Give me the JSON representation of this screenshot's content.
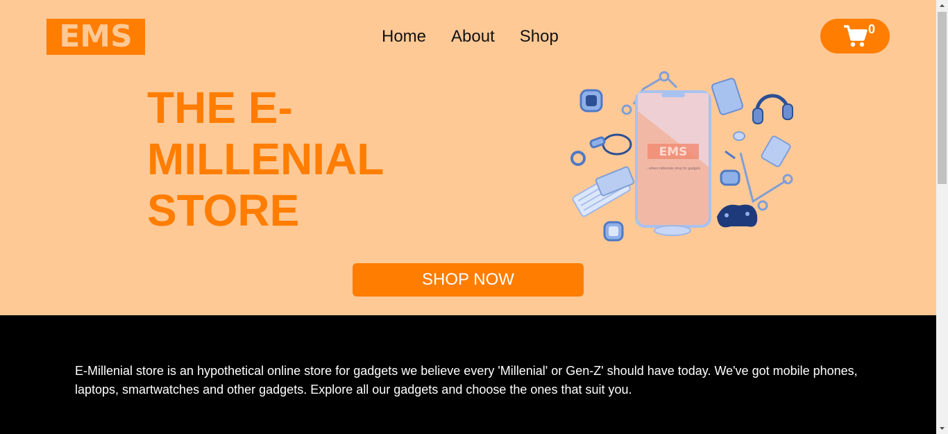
{
  "brand": {
    "logo_text": "EMS"
  },
  "nav": {
    "items": [
      {
        "label": "Home"
      },
      {
        "label": "About"
      },
      {
        "label": "Shop"
      }
    ]
  },
  "cart": {
    "count": "0",
    "icon": "cart-icon"
  },
  "hero": {
    "title_lines": [
      "THE E-",
      "MILLENIAL",
      "STORE"
    ],
    "cta_label": "SHOP NOW",
    "phone_screen_logo": "EMS",
    "phone_screen_tagline": "...where millenials shop for gadgets"
  },
  "about": {
    "text": "E-Millenial store is an hypothetical online store for gadgets we believe every 'Millenial' or Gen-Z' should have today. We've got mobile phones, laptops, smartwatches and other gadgets. Explore all our gadgets and choose the ones that suit you."
  },
  "colors": {
    "accent": "#ff7d00",
    "hero_bg": "#ffc996",
    "about_bg": "#000000"
  }
}
